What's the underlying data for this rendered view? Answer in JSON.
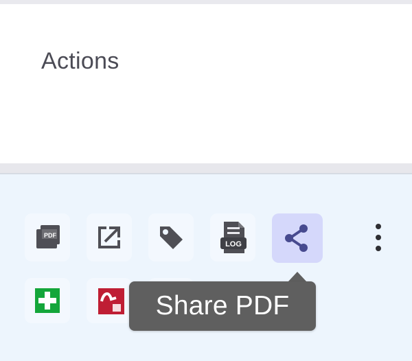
{
  "header": {
    "title": "Actions"
  },
  "actions": {
    "row1": [
      {
        "name": "view-pdf",
        "icon": "pdf-stack-icon"
      },
      {
        "name": "open-external",
        "icon": "external-link-icon"
      },
      {
        "name": "tag",
        "icon": "tag-icon"
      },
      {
        "name": "view-log",
        "icon": "log-document-icon"
      },
      {
        "name": "share-pdf",
        "icon": "share-icon"
      }
    ],
    "row2": [
      {
        "name": "add-record",
        "icon": "green-plus-icon"
      },
      {
        "name": "acrobat-document",
        "icon": "red-document-icon"
      },
      {
        "name": "hidden-green-action",
        "icon": "green-square-icon"
      }
    ],
    "more_icon": "vertical-dots-icon"
  },
  "tooltip": {
    "text": "Share PDF"
  },
  "colors": {
    "header_text": "#4b4b55",
    "row_background": "#edf5fd",
    "active_button": "#d5d8fb",
    "icon_dark": "#4f4f55",
    "share_icon": "#474a8f",
    "tooltip_background": "#5f5f5f",
    "green_action": "#14a63a",
    "red_document": "#bf1e34"
  }
}
